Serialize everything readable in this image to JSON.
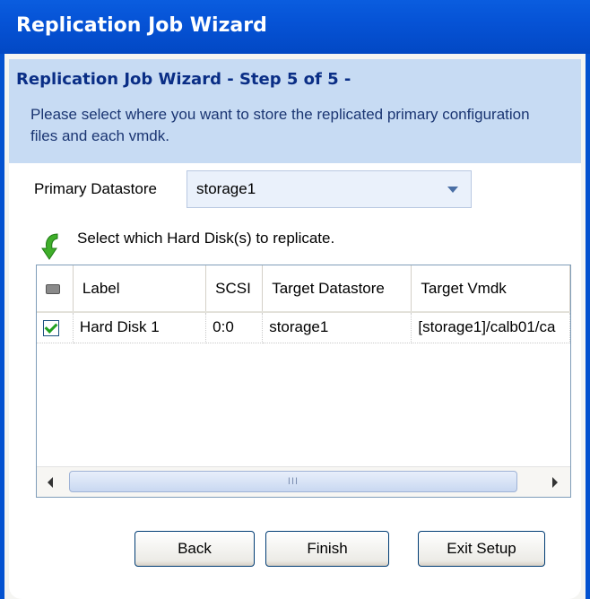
{
  "window": {
    "title": "Replication Job Wizard"
  },
  "header": {
    "step": "Replication Job Wizard - Step 5 of 5 -",
    "description": "Please select where you want to store the replicated primary configuration files and each vmdk."
  },
  "primary_datastore": {
    "label": "Primary Datastore",
    "selected": "storage1"
  },
  "disks": {
    "hint": "Select which Hard Disk(s) to replicate.",
    "columns": {
      "icon": "hard-disk-icon",
      "label": "Label",
      "scsi": "SCSI",
      "target_datastore": "Target Datastore",
      "target_vmdk": "Target Vmdk"
    },
    "rows": [
      {
        "checked": true,
        "label": "Hard Disk 1",
        "scsi": "0:0",
        "target_datastore": "storage1",
        "target_vmdk": "[storage1]/calb01/ca"
      }
    ],
    "scrollbar_grip": "III"
  },
  "buttons": {
    "back": "Back",
    "finish": "Finish",
    "exit": "Exit Setup"
  },
  "colors": {
    "titlebar": "#0653d6",
    "header_bg": "#c7dbf3",
    "step_text": "#0a2e86",
    "check_green": "#21a121"
  }
}
